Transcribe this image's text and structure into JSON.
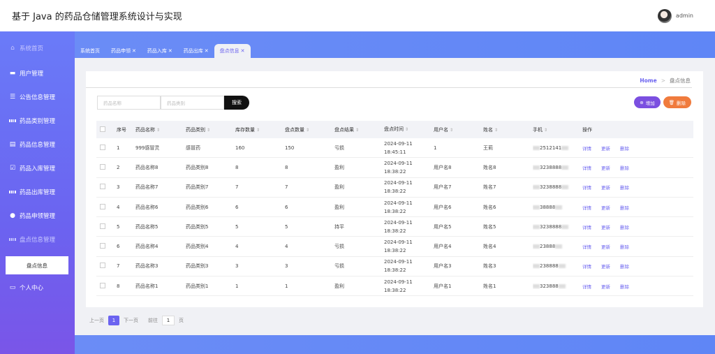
{
  "header": {
    "title": "基于 Java 的药品仓储管理系统设计与实现",
    "username": "admin"
  },
  "sidebar": {
    "items": [
      {
        "label": "系统首页",
        "icon": "home-icon"
      },
      {
        "label": "用户管理",
        "icon": "monitor-icon"
      },
      {
        "label": "公告信息管理",
        "icon": "list-icon"
      },
      {
        "label": "药品类别管理",
        "icon": "grid-icon"
      },
      {
        "label": "药品信息管理",
        "icon": "document-icon"
      },
      {
        "label": "药品入库管理",
        "icon": "check-icon"
      },
      {
        "label": "药品出库管理",
        "icon": "grid-icon"
      },
      {
        "label": "药品申领管理",
        "icon": "user-icon"
      },
      {
        "label": "盘点信息管理",
        "icon": "grid-icon"
      },
      {
        "label": "个人中心",
        "icon": "card-icon"
      }
    ],
    "sub_item": "盘点信息"
  },
  "tabs": [
    "系统首页",
    "药品申领",
    "药品入库",
    "药品出库",
    "盘点信息"
  ],
  "tab_close": "✕",
  "breadcrumb": {
    "home": "Home",
    "sep": ">",
    "current": "盘点信息"
  },
  "search": {
    "name_placeholder": "药品名称",
    "type_placeholder": "药品类别",
    "button": "搜索"
  },
  "actions": {
    "add": "增加",
    "delete": "删除"
  },
  "table": {
    "headers": [
      "序号",
      "药品名称",
      "药品类别",
      "库存数量",
      "盘点数量",
      "盘点结果",
      "盘点时间",
      "用户名",
      "姓名",
      "手机",
      "操作"
    ],
    "row_actions": [
      "详情",
      "更新",
      "删除"
    ],
    "rows": [
      [
        "1",
        "999感冒灵",
        "感冒药",
        "160",
        "150",
        "亏损",
        "2024-09-11 18:45:11",
        "1",
        "王莉",
        "2512141"
      ],
      [
        "2",
        "药品名称8",
        "药品类别8",
        "8",
        "8",
        "盈利",
        "2024-09-11 18:38:22",
        "用户名8",
        "姓名8",
        "3238888"
      ],
      [
        "3",
        "药品名称7",
        "药品类别7",
        "7",
        "7",
        "盈利",
        "2024-09-11 18:38:22",
        "用户名7",
        "姓名7",
        "3238888"
      ],
      [
        "4",
        "药品名称6",
        "药品类别6",
        "6",
        "6",
        "盈利",
        "2024-09-11 18:38:22",
        "用户名6",
        "姓名6",
        "38888"
      ],
      [
        "5",
        "药品名称5",
        "药品类别5",
        "5",
        "5",
        "持平",
        "2024-09-11 18:38:22",
        "用户名5",
        "姓名5",
        "3238888"
      ],
      [
        "6",
        "药品名称4",
        "药品类别4",
        "4",
        "4",
        "亏损",
        "2024-09-11 18:38:22",
        "用户名4",
        "姓名4",
        "23888"
      ],
      [
        "7",
        "药品名称3",
        "药品类别3",
        "3",
        "3",
        "亏损",
        "2024-09-11 18:38:22",
        "用户名3",
        "姓名3",
        "238888"
      ],
      [
        "8",
        "药品名称1",
        "药品类别1",
        "1",
        "1",
        "盈利",
        "2024-09-11 18:38:22",
        "用户名1",
        "姓名1",
        "323888"
      ]
    ]
  },
  "pager": {
    "prev": "上一页",
    "page": "1",
    "next": "下一页",
    "goto": "前往",
    "goto_value": "1",
    "unit": "页"
  },
  "colors": {
    "accent": "#6b63f0",
    "delete": "#f07b3d",
    "add": "#7b4fe0"
  }
}
